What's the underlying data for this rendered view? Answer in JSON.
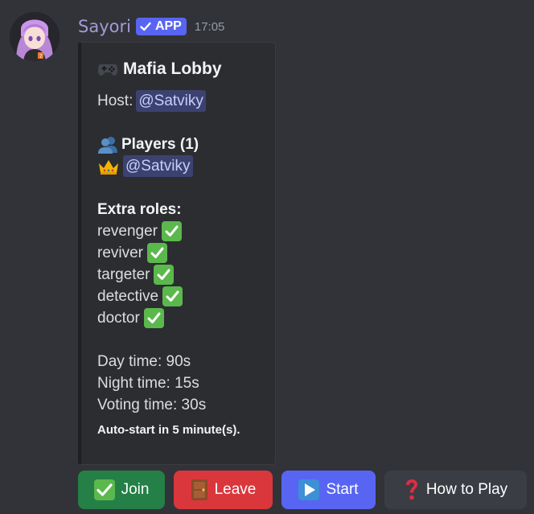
{
  "message": {
    "username": "Sayori",
    "badge": "APP",
    "timestamp": "17:05"
  },
  "embed": {
    "title": "Mafia Lobby",
    "host_label": "Host:",
    "host_mention": "@Satviky",
    "players_heading": "Players (1)",
    "players": [
      "@Satviky"
    ],
    "extra_roles_heading": "Extra roles:",
    "roles": [
      "revenger",
      "reviver",
      "targeter",
      "detective",
      "doctor"
    ],
    "day_time": "Day time: 90s",
    "night_time": "Night time: 15s",
    "voting_time": "Voting time: 30s",
    "auto_start": "Auto-start in 5 minute(s)."
  },
  "buttons": {
    "join": "Join",
    "leave": "Leave",
    "start": "Start",
    "how_to_play": "How to Play"
  },
  "colors": {
    "background": "#313338",
    "username": "#a29bd6",
    "badge": "#5865f2",
    "join": "#248046",
    "leave": "#da373c",
    "start": "#5865f2",
    "how_to_play": "#3b3d44",
    "check_emoji": "#5bb84c"
  },
  "icons": {
    "title": "game-controller-icon",
    "players": "busts-icon",
    "host_player": "crown-icon",
    "role_enabled": "check-mark-icon",
    "join": "check-mark-icon",
    "leave": "door-icon",
    "start": "play-icon",
    "how_to_play": "question-mark-icon"
  }
}
